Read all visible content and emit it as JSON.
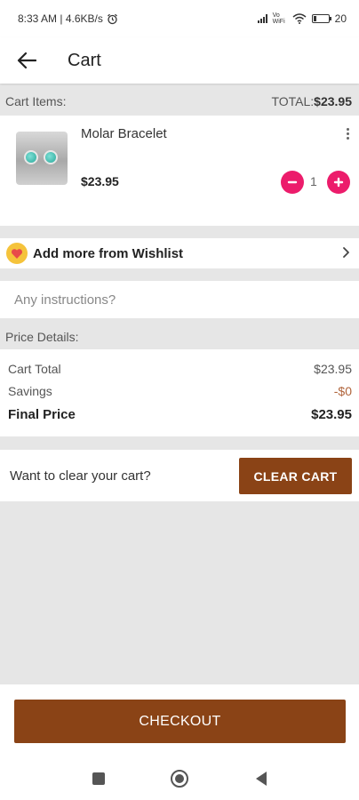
{
  "status_bar": {
    "time_and_speed": "8:33 AM | 4.6KB/s",
    "vowifi": "Vo WiFi",
    "battery_label": "20",
    "battery_level": 0.2
  },
  "app_bar": {
    "title": "Cart",
    "back_icon": "arrow-left-icon"
  },
  "cart_header": {
    "label": "Cart Items:",
    "total_prefix": "TOTAL:",
    "total_value": "$23.95"
  },
  "item": {
    "name": "Molar Bracelet",
    "price": "$23.95",
    "quantity": "1",
    "minus_label": "−",
    "plus_label": "+",
    "accent": "#ec1c6b"
  },
  "wishlist": {
    "label": "Add more from Wishlist",
    "icon": "heart-icon",
    "chevron": "chevron-right-icon"
  },
  "instructions": {
    "placeholder": "Any instructions?"
  },
  "price_details": {
    "header": "Price Details:",
    "rows": [
      {
        "label": "Cart Total",
        "value": "$23.95"
      },
      {
        "label": "Savings",
        "value": "-$0"
      },
      {
        "label": "Final Price",
        "value": "$23.95"
      }
    ]
  },
  "clear_cart": {
    "question": "Want to clear your cart?",
    "button_label": "CLEAR CART"
  },
  "checkout": {
    "button_label": "CHECKOUT"
  },
  "brand_color": "#8a4316",
  "nav_bar": {
    "icons": [
      "recents-square-icon",
      "home-circle-icon",
      "back-triangle-icon"
    ]
  }
}
